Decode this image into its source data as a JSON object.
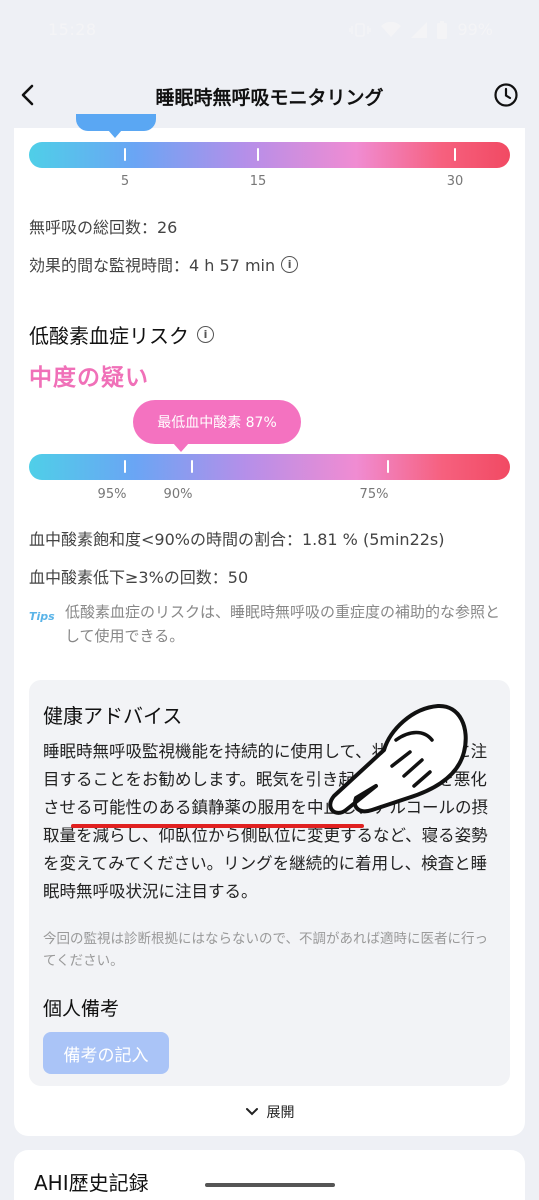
{
  "status_bar": {
    "time": "15:28",
    "battery": "99%"
  },
  "header": {
    "title": "睡眠時無呼吸モニタリング"
  },
  "apnea_scale": {
    "ticks": [
      "5",
      "15",
      "30"
    ]
  },
  "apnea_stats": {
    "total_count": "無呼吸の総回数：26",
    "effective_time": "効果的間な監視時間：4 h 57 min"
  },
  "hypoxemia": {
    "title": "低酸素血症リスク",
    "level": "中度の疑い",
    "lowest_o2_label": "最低血中酸素 87%",
    "ticks": [
      "95%",
      "90%",
      "75%"
    ],
    "below90_ratio": "血中酸素飽和度<90%の時間の割合：1.81 % (5min22s)",
    "drop_count": "血中酸素低下≥3%の回数：50"
  },
  "tips": {
    "icon": "Tips",
    "text": "低酸素血症のリスクは、睡眠時無呼吸の重症度の補助的な参照として使用できる。"
  },
  "advice": {
    "title": "健康アドバイス",
    "body": "睡眠時無呼吸監視機能を持続的に使用して、状況の変化に注目することをお勧めします。眠気を引き起こし、眠きを悪化させる可能性のある鎮静薬の服用を中止し、アルコールの摂取量を減らし、仰臥位から側臥位に変更するなど、寝る姿勢を変えてみてください。リングを継続的に着用し、検査と睡眠時無呼吸状況に注目する。",
    "note": "今回の監視は診断根拠にはならないので、不調があれば適時に医者に行ってください。"
  },
  "personal_note": {
    "title": "個人備考",
    "button": "備考の記入"
  },
  "expand": {
    "label": "展開"
  },
  "history": {
    "title": "AHI歴史記録"
  },
  "colors": {
    "accent_pink": "#f070b8",
    "bubble_blue": "#5aa7f3",
    "note_button": "#aac4f7",
    "underline_red": "#e02020"
  }
}
